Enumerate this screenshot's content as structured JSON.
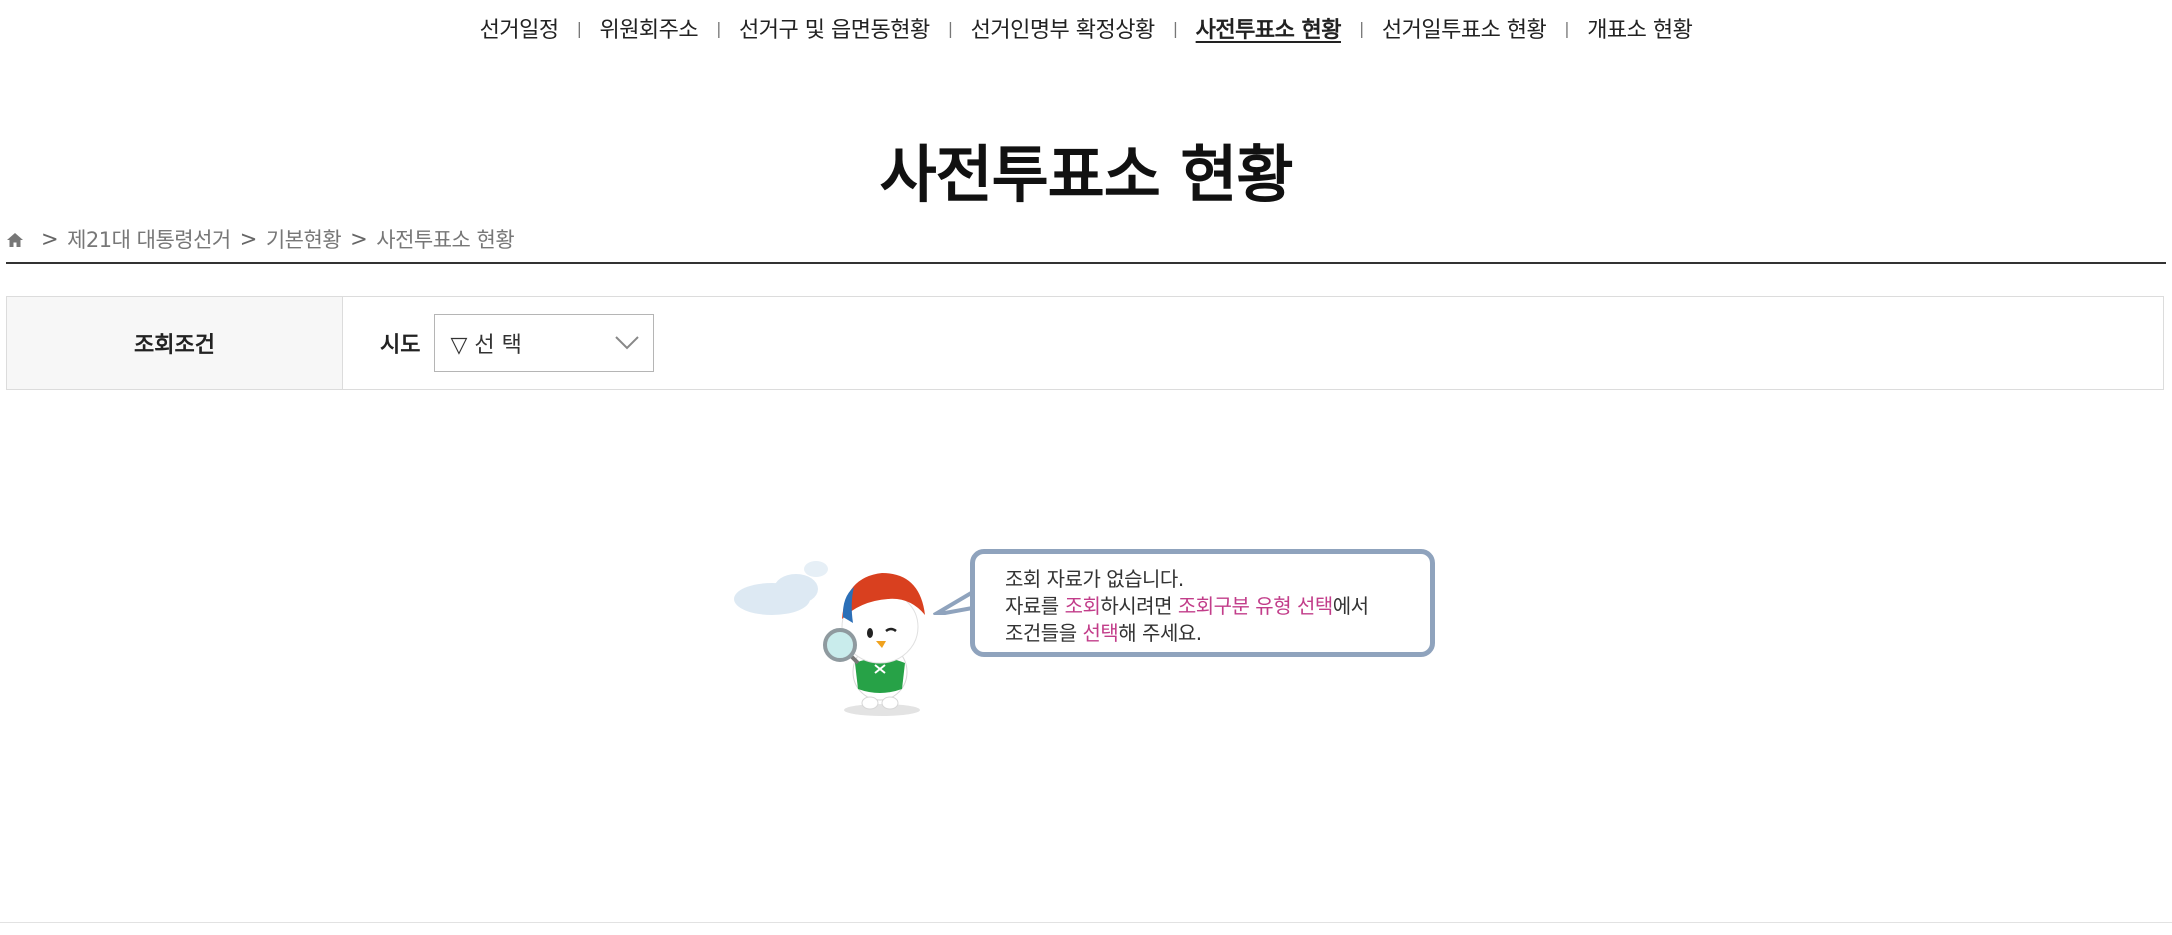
{
  "topnav": {
    "items": [
      {
        "label": "선거일정"
      },
      {
        "label": "위원회주소"
      },
      {
        "label": "선거구 및 읍면동현황"
      },
      {
        "label": "선거인명부 확정상황"
      },
      {
        "label": "사전투표소 현황"
      },
      {
        "label": "선거일투표소 현황"
      },
      {
        "label": "개표소 현황"
      }
    ],
    "separator": "|",
    "active_index": 4
  },
  "page_title": "사전투표소 현황",
  "breadcrumb": {
    "items": [
      "제21대 대통령선거",
      "기본현황",
      "사전투표소 현황"
    ],
    "separator": ">"
  },
  "search": {
    "condition_label": "조회조건",
    "sido_label": "시도",
    "sido_select_value": "▽ 선 택"
  },
  "empty_state": {
    "line1": "조회 자료가 없습니다.",
    "line2_a": "자료를 ",
    "line2_hl1": "조회",
    "line2_b": "하시려면 ",
    "line2_hl2": "조회구분 유형 선택",
    "line2_c": "에서",
    "line3_a": "조건들을 ",
    "line3_hl": "선택",
    "line3_b": "해 주세요."
  },
  "colors": {
    "highlight": "#c23d8a",
    "bubble_border": "#8fa3bd",
    "label_bg": "#f7f7f7"
  },
  "icons": {
    "home": "home-icon",
    "select_arrow": "chevron-down-icon"
  }
}
